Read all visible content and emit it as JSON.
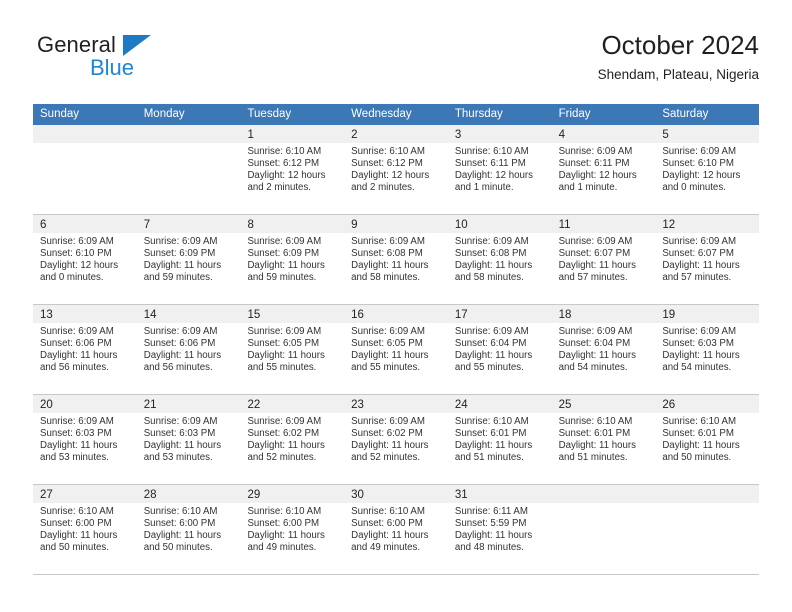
{
  "brand": {
    "name_top": "General",
    "name_bottom": "Blue",
    "triangle_icon": "triangle-flag-icon",
    "color_dark": "#231f20",
    "color_blue": "#1f86d0"
  },
  "header": {
    "title": "October 2024",
    "subtitle": "Shendam, Plateau, Nigeria"
  },
  "theme": {
    "header_bar": "#3b78b5",
    "day_number_strip": "#f0f0f0",
    "grid_line": "#c8c8c8",
    "text": "#231f20"
  },
  "weekdays": [
    "Sunday",
    "Monday",
    "Tuesday",
    "Wednesday",
    "Thursday",
    "Friday",
    "Saturday"
  ],
  "labels": {
    "sunrise": "Sunrise:",
    "sunset": "Sunset:",
    "daylight": "Daylight:"
  },
  "weeks": [
    [
      {
        "day": "",
        "sunrise": "",
        "sunset": "",
        "daylight_line1": "",
        "daylight_line2": ""
      },
      {
        "day": "",
        "sunrise": "",
        "sunset": "",
        "daylight_line1": "",
        "daylight_line2": ""
      },
      {
        "day": "1",
        "sunrise": "Sunrise: 6:10 AM",
        "sunset": "Sunset: 6:12 PM",
        "daylight_line1": "Daylight: 12 hours",
        "daylight_line2": "and 2 minutes."
      },
      {
        "day": "2",
        "sunrise": "Sunrise: 6:10 AM",
        "sunset": "Sunset: 6:12 PM",
        "daylight_line1": "Daylight: 12 hours",
        "daylight_line2": "and 2 minutes."
      },
      {
        "day": "3",
        "sunrise": "Sunrise: 6:10 AM",
        "sunset": "Sunset: 6:11 PM",
        "daylight_line1": "Daylight: 12 hours",
        "daylight_line2": "and 1 minute."
      },
      {
        "day": "4",
        "sunrise": "Sunrise: 6:09 AM",
        "sunset": "Sunset: 6:11 PM",
        "daylight_line1": "Daylight: 12 hours",
        "daylight_line2": "and 1 minute."
      },
      {
        "day": "5",
        "sunrise": "Sunrise: 6:09 AM",
        "sunset": "Sunset: 6:10 PM",
        "daylight_line1": "Daylight: 12 hours",
        "daylight_line2": "and 0 minutes."
      }
    ],
    [
      {
        "day": "6",
        "sunrise": "Sunrise: 6:09 AM",
        "sunset": "Sunset: 6:10 PM",
        "daylight_line1": "Daylight: 12 hours",
        "daylight_line2": "and 0 minutes."
      },
      {
        "day": "7",
        "sunrise": "Sunrise: 6:09 AM",
        "sunset": "Sunset: 6:09 PM",
        "daylight_line1": "Daylight: 11 hours",
        "daylight_line2": "and 59 minutes."
      },
      {
        "day": "8",
        "sunrise": "Sunrise: 6:09 AM",
        "sunset": "Sunset: 6:09 PM",
        "daylight_line1": "Daylight: 11 hours",
        "daylight_line2": "and 59 minutes."
      },
      {
        "day": "9",
        "sunrise": "Sunrise: 6:09 AM",
        "sunset": "Sunset: 6:08 PM",
        "daylight_line1": "Daylight: 11 hours",
        "daylight_line2": "and 58 minutes."
      },
      {
        "day": "10",
        "sunrise": "Sunrise: 6:09 AM",
        "sunset": "Sunset: 6:08 PM",
        "daylight_line1": "Daylight: 11 hours",
        "daylight_line2": "and 58 minutes."
      },
      {
        "day": "11",
        "sunrise": "Sunrise: 6:09 AM",
        "sunset": "Sunset: 6:07 PM",
        "daylight_line1": "Daylight: 11 hours",
        "daylight_line2": "and 57 minutes."
      },
      {
        "day": "12",
        "sunrise": "Sunrise: 6:09 AM",
        "sunset": "Sunset: 6:07 PM",
        "daylight_line1": "Daylight: 11 hours",
        "daylight_line2": "and 57 minutes."
      }
    ],
    [
      {
        "day": "13",
        "sunrise": "Sunrise: 6:09 AM",
        "sunset": "Sunset: 6:06 PM",
        "daylight_line1": "Daylight: 11 hours",
        "daylight_line2": "and 56 minutes."
      },
      {
        "day": "14",
        "sunrise": "Sunrise: 6:09 AM",
        "sunset": "Sunset: 6:06 PM",
        "daylight_line1": "Daylight: 11 hours",
        "daylight_line2": "and 56 minutes."
      },
      {
        "day": "15",
        "sunrise": "Sunrise: 6:09 AM",
        "sunset": "Sunset: 6:05 PM",
        "daylight_line1": "Daylight: 11 hours",
        "daylight_line2": "and 55 minutes."
      },
      {
        "day": "16",
        "sunrise": "Sunrise: 6:09 AM",
        "sunset": "Sunset: 6:05 PM",
        "daylight_line1": "Daylight: 11 hours",
        "daylight_line2": "and 55 minutes."
      },
      {
        "day": "17",
        "sunrise": "Sunrise: 6:09 AM",
        "sunset": "Sunset: 6:04 PM",
        "daylight_line1": "Daylight: 11 hours",
        "daylight_line2": "and 55 minutes."
      },
      {
        "day": "18",
        "sunrise": "Sunrise: 6:09 AM",
        "sunset": "Sunset: 6:04 PM",
        "daylight_line1": "Daylight: 11 hours",
        "daylight_line2": "and 54 minutes."
      },
      {
        "day": "19",
        "sunrise": "Sunrise: 6:09 AM",
        "sunset": "Sunset: 6:03 PM",
        "daylight_line1": "Daylight: 11 hours",
        "daylight_line2": "and 54 minutes."
      }
    ],
    [
      {
        "day": "20",
        "sunrise": "Sunrise: 6:09 AM",
        "sunset": "Sunset: 6:03 PM",
        "daylight_line1": "Daylight: 11 hours",
        "daylight_line2": "and 53 minutes."
      },
      {
        "day": "21",
        "sunrise": "Sunrise: 6:09 AM",
        "sunset": "Sunset: 6:03 PM",
        "daylight_line1": "Daylight: 11 hours",
        "daylight_line2": "and 53 minutes."
      },
      {
        "day": "22",
        "sunrise": "Sunrise: 6:09 AM",
        "sunset": "Sunset: 6:02 PM",
        "daylight_line1": "Daylight: 11 hours",
        "daylight_line2": "and 52 minutes."
      },
      {
        "day": "23",
        "sunrise": "Sunrise: 6:09 AM",
        "sunset": "Sunset: 6:02 PM",
        "daylight_line1": "Daylight: 11 hours",
        "daylight_line2": "and 52 minutes."
      },
      {
        "day": "24",
        "sunrise": "Sunrise: 6:10 AM",
        "sunset": "Sunset: 6:01 PM",
        "daylight_line1": "Daylight: 11 hours",
        "daylight_line2": "and 51 minutes."
      },
      {
        "day": "25",
        "sunrise": "Sunrise: 6:10 AM",
        "sunset": "Sunset: 6:01 PM",
        "daylight_line1": "Daylight: 11 hours",
        "daylight_line2": "and 51 minutes."
      },
      {
        "day": "26",
        "sunrise": "Sunrise: 6:10 AM",
        "sunset": "Sunset: 6:01 PM",
        "daylight_line1": "Daylight: 11 hours",
        "daylight_line2": "and 50 minutes."
      }
    ],
    [
      {
        "day": "27",
        "sunrise": "Sunrise: 6:10 AM",
        "sunset": "Sunset: 6:00 PM",
        "daylight_line1": "Daylight: 11 hours",
        "daylight_line2": "and 50 minutes."
      },
      {
        "day": "28",
        "sunrise": "Sunrise: 6:10 AM",
        "sunset": "Sunset: 6:00 PM",
        "daylight_line1": "Daylight: 11 hours",
        "daylight_line2": "and 50 minutes."
      },
      {
        "day": "29",
        "sunrise": "Sunrise: 6:10 AM",
        "sunset": "Sunset: 6:00 PM",
        "daylight_line1": "Daylight: 11 hours",
        "daylight_line2": "and 49 minutes."
      },
      {
        "day": "30",
        "sunrise": "Sunrise: 6:10 AM",
        "sunset": "Sunset: 6:00 PM",
        "daylight_line1": "Daylight: 11 hours",
        "daylight_line2": "and 49 minutes."
      },
      {
        "day": "31",
        "sunrise": "Sunrise: 6:11 AM",
        "sunset": "Sunset: 5:59 PM",
        "daylight_line1": "Daylight: 11 hours",
        "daylight_line2": "and 48 minutes."
      },
      {
        "day": "",
        "sunrise": "",
        "sunset": "",
        "daylight_line1": "",
        "daylight_line2": ""
      },
      {
        "day": "",
        "sunrise": "",
        "sunset": "",
        "daylight_line1": "",
        "daylight_line2": ""
      }
    ]
  ]
}
